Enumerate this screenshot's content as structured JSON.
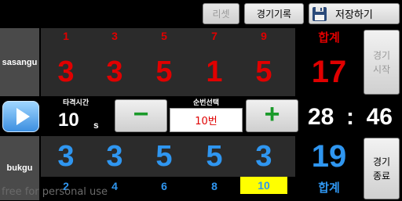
{
  "toolbar": {
    "reset_label": "리셋",
    "record_label": "경기기록",
    "save_label": "저장하기"
  },
  "away": {
    "name": "sasangu",
    "innings": [
      "1",
      "3",
      "5",
      "7",
      "9"
    ],
    "scores": [
      "3",
      "3",
      "5",
      "1",
      "5"
    ],
    "total_label": "합계",
    "total": "17"
  },
  "home": {
    "name": "bukgu",
    "innings": [
      "2",
      "4",
      "6",
      "8",
      "10"
    ],
    "scores": [
      "3",
      "3",
      "5",
      "5",
      "3"
    ],
    "total_label": "합계",
    "total": "19",
    "highlight_inning": "10"
  },
  "controls": {
    "hit_time_label": "타격시간",
    "hit_time_value": "10",
    "hit_time_unit": "s",
    "order_label": "순번선택",
    "order_value": "10번",
    "minus_label": "−",
    "plus_label": "+"
  },
  "clock": {
    "minutes": "28",
    "separator": ":",
    "seconds": "46"
  },
  "side_buttons": {
    "start_line1": "경기",
    "start_line2": "시작",
    "end_line1": "경기",
    "end_line2": "종료"
  },
  "watermark": "free for personal use",
  "colors": {
    "away": "#e00000",
    "home": "#2f96f0",
    "plus_minus": "#1a9a2a",
    "highlight": "#ffff00"
  },
  "icons": {
    "play": "play-icon",
    "save": "floppy-disk-icon"
  }
}
